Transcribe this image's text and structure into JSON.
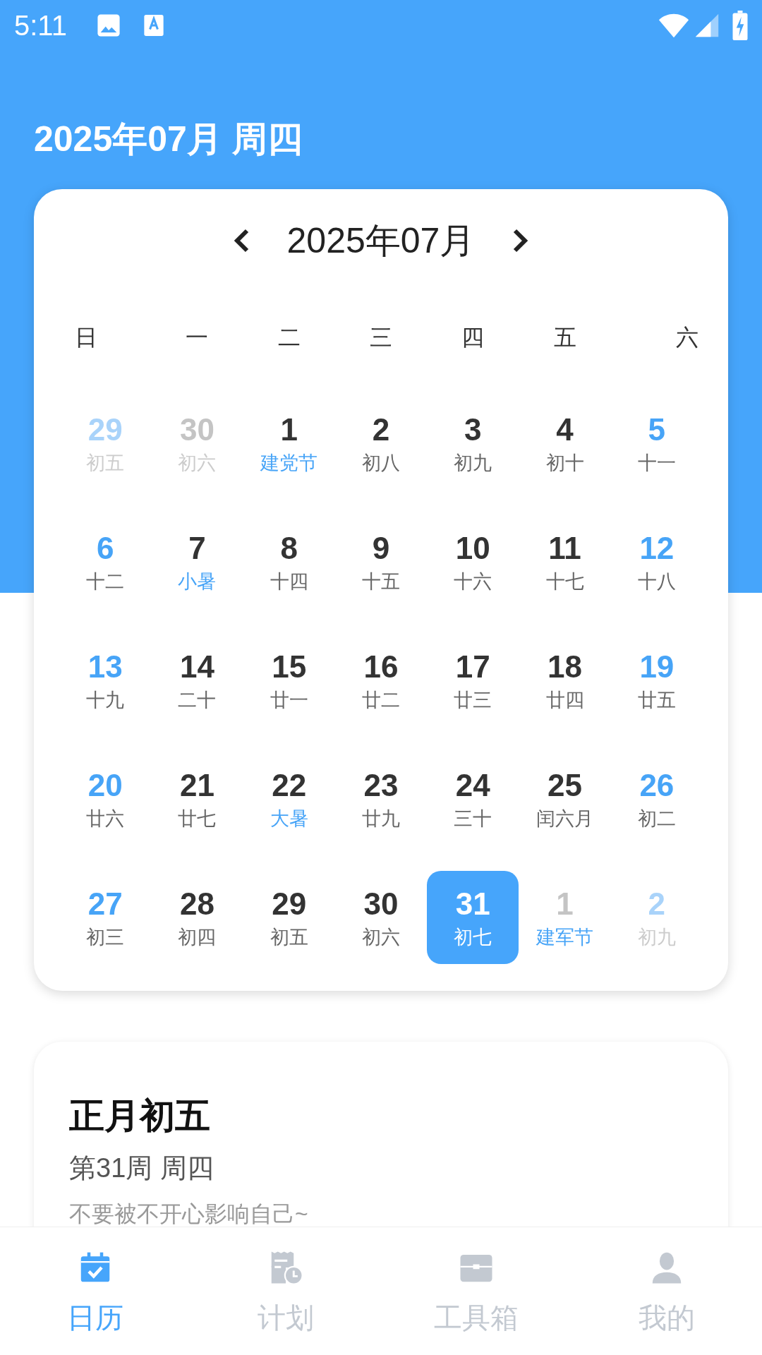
{
  "status_bar": {
    "time": "5:11"
  },
  "header": {
    "title": "2025年07月 周四"
  },
  "calendar": {
    "month_label": "2025年07月",
    "weekdays": [
      "日",
      "一",
      "二",
      "三",
      "四",
      "五",
      "六"
    ],
    "days": [
      {
        "day": "29",
        "lunar": "初五",
        "in_month": false,
        "weekend": true,
        "festival": false,
        "selected": false
      },
      {
        "day": "30",
        "lunar": "初六",
        "in_month": false,
        "weekend": false,
        "festival": false,
        "selected": false
      },
      {
        "day": "1",
        "lunar": "建党节",
        "in_month": true,
        "weekend": false,
        "festival": true,
        "selected": false
      },
      {
        "day": "2",
        "lunar": "初八",
        "in_month": true,
        "weekend": false,
        "festival": false,
        "selected": false
      },
      {
        "day": "3",
        "lunar": "初九",
        "in_month": true,
        "weekend": false,
        "festival": false,
        "selected": false
      },
      {
        "day": "4",
        "lunar": "初十",
        "in_month": true,
        "weekend": false,
        "festival": false,
        "selected": false
      },
      {
        "day": "5",
        "lunar": "十一",
        "in_month": true,
        "weekend": true,
        "festival": false,
        "selected": false
      },
      {
        "day": "6",
        "lunar": "十二",
        "in_month": true,
        "weekend": true,
        "festival": false,
        "selected": false
      },
      {
        "day": "7",
        "lunar": "小暑",
        "in_month": true,
        "weekend": false,
        "festival": true,
        "selected": false
      },
      {
        "day": "8",
        "lunar": "十四",
        "in_month": true,
        "weekend": false,
        "festival": false,
        "selected": false
      },
      {
        "day": "9",
        "lunar": "十五",
        "in_month": true,
        "weekend": false,
        "festival": false,
        "selected": false
      },
      {
        "day": "10",
        "lunar": "十六",
        "in_month": true,
        "weekend": false,
        "festival": false,
        "selected": false
      },
      {
        "day": "11",
        "lunar": "十七",
        "in_month": true,
        "weekend": false,
        "festival": false,
        "selected": false
      },
      {
        "day": "12",
        "lunar": "十八",
        "in_month": true,
        "weekend": true,
        "festival": false,
        "selected": false
      },
      {
        "day": "13",
        "lunar": "十九",
        "in_month": true,
        "weekend": true,
        "festival": false,
        "selected": false
      },
      {
        "day": "14",
        "lunar": "二十",
        "in_month": true,
        "weekend": false,
        "festival": false,
        "selected": false
      },
      {
        "day": "15",
        "lunar": "廿一",
        "in_month": true,
        "weekend": false,
        "festival": false,
        "selected": false
      },
      {
        "day": "16",
        "lunar": "廿二",
        "in_month": true,
        "weekend": false,
        "festival": false,
        "selected": false
      },
      {
        "day": "17",
        "lunar": "廿三",
        "in_month": true,
        "weekend": false,
        "festival": false,
        "selected": false
      },
      {
        "day": "18",
        "lunar": "廿四",
        "in_month": true,
        "weekend": false,
        "festival": false,
        "selected": false
      },
      {
        "day": "19",
        "lunar": "廿五",
        "in_month": true,
        "weekend": true,
        "festival": false,
        "selected": false
      },
      {
        "day": "20",
        "lunar": "廿六",
        "in_month": true,
        "weekend": true,
        "festival": false,
        "selected": false
      },
      {
        "day": "21",
        "lunar": "廿七",
        "in_month": true,
        "weekend": false,
        "festival": false,
        "selected": false
      },
      {
        "day": "22",
        "lunar": "大暑",
        "in_month": true,
        "weekend": false,
        "festival": true,
        "selected": false
      },
      {
        "day": "23",
        "lunar": "廿九",
        "in_month": true,
        "weekend": false,
        "festival": false,
        "selected": false
      },
      {
        "day": "24",
        "lunar": "三十",
        "in_month": true,
        "weekend": false,
        "festival": false,
        "selected": false
      },
      {
        "day": "25",
        "lunar": "闰六月",
        "in_month": true,
        "weekend": false,
        "festival": false,
        "selected": false
      },
      {
        "day": "26",
        "lunar": "初二",
        "in_month": true,
        "weekend": true,
        "festival": false,
        "selected": false
      },
      {
        "day": "27",
        "lunar": "初三",
        "in_month": true,
        "weekend": true,
        "festival": false,
        "selected": false
      },
      {
        "day": "28",
        "lunar": "初四",
        "in_month": true,
        "weekend": false,
        "festival": false,
        "selected": false
      },
      {
        "day": "29",
        "lunar": "初五",
        "in_month": true,
        "weekend": false,
        "festival": false,
        "selected": false
      },
      {
        "day": "30",
        "lunar": "初六",
        "in_month": true,
        "weekend": false,
        "festival": false,
        "selected": false
      },
      {
        "day": "31",
        "lunar": "初七",
        "selected": true
      },
      {
        "day": "1",
        "lunar": "建军节",
        "in_month": false,
        "weekend": false,
        "festival": true,
        "selected": false
      },
      {
        "day": "2",
        "lunar": "初九",
        "in_month": false,
        "weekend": true,
        "festival": false,
        "selected": false
      }
    ]
  },
  "info_card": {
    "title": "正月初五",
    "subtitle": "第31周 周四",
    "quote": "不要被不开心影响自己~"
  },
  "bottom_nav": [
    {
      "kind": "calendar",
      "label": "日历",
      "selected": true
    },
    {
      "kind": "plan",
      "label": "计划",
      "selected": false
    },
    {
      "kind": "toolbox",
      "label": "工具箱",
      "selected": false
    },
    {
      "kind": "profile",
      "label": "我的",
      "selected": false
    }
  ]
}
